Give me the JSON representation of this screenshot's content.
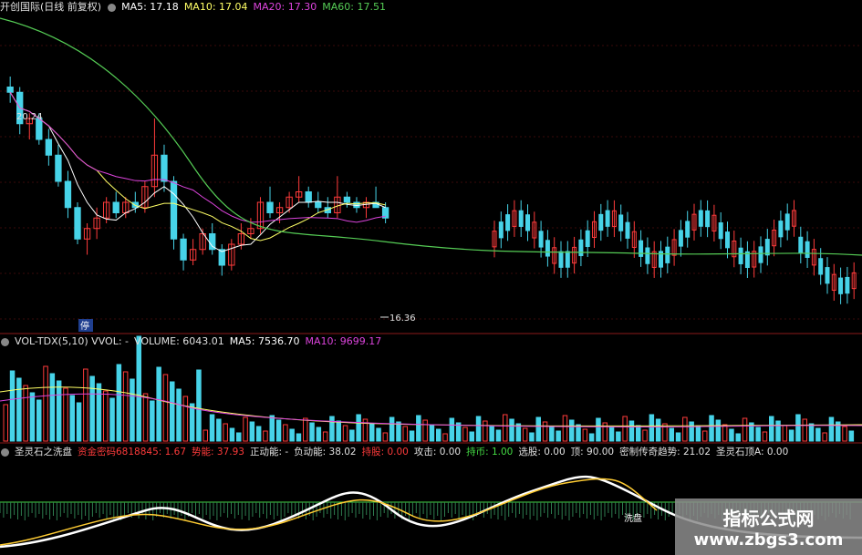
{
  "price_header": {
    "title": "开创国际(日线 前复权)",
    "ma5": "MA5: 17.18",
    "ma10": "MA10: 17.04",
    "ma20": "MA20: 17.30",
    "ma60": "MA60: 17.51"
  },
  "vol_header": {
    "title": "VOL-TDX(5,10) VVOL: -",
    "volume": "VOLUME: 6043.01",
    "ma5": "MA5: 7536.70",
    "ma10": "MA10: 9699.17"
  },
  "ind_header": {
    "title": "圣灵石之洗盘",
    "fund": "资金密码6818845: 1.67",
    "power": "势能: 37.93",
    "pos": "正动能: -",
    "neg": "负动能: 38.02",
    "hold": "持股: 0.00",
    "attack": "攻击: 0.00",
    "coin": "持币: 1.00",
    "pick": "选股: 0.00",
    "top": "顶: 90.00",
    "trend": "密制传奇趋势: 21.02",
    "stoneA": "圣灵石顶A: 0.00"
  },
  "annotations": {
    "high": "20.24",
    "low": "16.36",
    "stop": "停",
    "wash": "洗盘"
  },
  "watermark": {
    "line1": "指标公式网",
    "line2": "www.zbgs3.com"
  },
  "colors": {
    "up": "#ff3b3b",
    "down": "#47d3e8",
    "ma5": "#ffffff",
    "ma10": "#ffff66",
    "ma20": "#dd44dd",
    "ma60": "#55cc55"
  },
  "chart_data": {
    "type": "candlestick",
    "price_high_label": 20.24,
    "price_low_label": 16.36,
    "ylim": [
      15.5,
      21.5
    ],
    "candles": [
      [
        20.1,
        20.3,
        19.8,
        20.0
      ],
      [
        20.0,
        20.1,
        19.2,
        19.4
      ],
      [
        19.4,
        19.6,
        19.1,
        19.5
      ],
      [
        19.5,
        19.6,
        19.0,
        19.1
      ],
      [
        19.1,
        19.3,
        18.6,
        18.8
      ],
      [
        18.8,
        19.0,
        18.2,
        18.3
      ],
      [
        18.3,
        18.5,
        17.6,
        17.8
      ],
      [
        17.8,
        17.9,
        17.1,
        17.2
      ],
      [
        17.2,
        17.5,
        16.9,
        17.4
      ],
      [
        17.4,
        17.8,
        17.2,
        17.6
      ],
      [
        17.6,
        18.0,
        17.5,
        17.9
      ],
      [
        17.9,
        18.1,
        17.6,
        17.7
      ],
      [
        17.7,
        18.0,
        17.6,
        17.9
      ],
      [
        17.9,
        18.1,
        17.7,
        17.8
      ],
      [
        17.8,
        18.3,
        17.7,
        18.2
      ],
      [
        18.2,
        19.5,
        18.0,
        18.8
      ],
      [
        18.8,
        19.0,
        18.1,
        18.3
      ],
      [
        18.3,
        18.4,
        17.0,
        17.2
      ],
      [
        17.2,
        17.3,
        16.6,
        16.8
      ],
      [
        16.8,
        17.2,
        16.7,
        17.0
      ],
      [
        17.0,
        17.4,
        16.9,
        17.3
      ],
      [
        17.3,
        17.5,
        16.9,
        17.0
      ],
      [
        17.0,
        17.1,
        16.5,
        16.7
      ],
      [
        16.7,
        17.2,
        16.6,
        17.1
      ],
      [
        17.1,
        17.5,
        17.0,
        17.3
      ],
      [
        17.3,
        17.6,
        17.2,
        17.4
      ],
      [
        17.4,
        18.0,
        17.3,
        17.9
      ],
      [
        17.9,
        18.2,
        17.6,
        17.7
      ],
      [
        17.7,
        17.9,
        17.5,
        17.8
      ],
      [
        17.8,
        18.1,
        17.7,
        18.0
      ],
      [
        18.0,
        18.4,
        17.9,
        18.1
      ],
      [
        18.1,
        18.2,
        17.8,
        17.9
      ],
      [
        17.9,
        18.1,
        17.7,
        17.8
      ],
      [
        17.8,
        18.0,
        17.6,
        17.7
      ],
      [
        17.7,
        18.4,
        17.6,
        18.0
      ],
      [
        18.0,
        18.1,
        17.8,
        17.9
      ],
      [
        17.9,
        18.0,
        17.7,
        17.8
      ],
      [
        17.8,
        18.0,
        17.6,
        17.9
      ],
      [
        17.9,
        18.2,
        17.8,
        17.8
      ],
      [
        17.8,
        17.9,
        17.5,
        17.6
      ]
    ]
  }
}
